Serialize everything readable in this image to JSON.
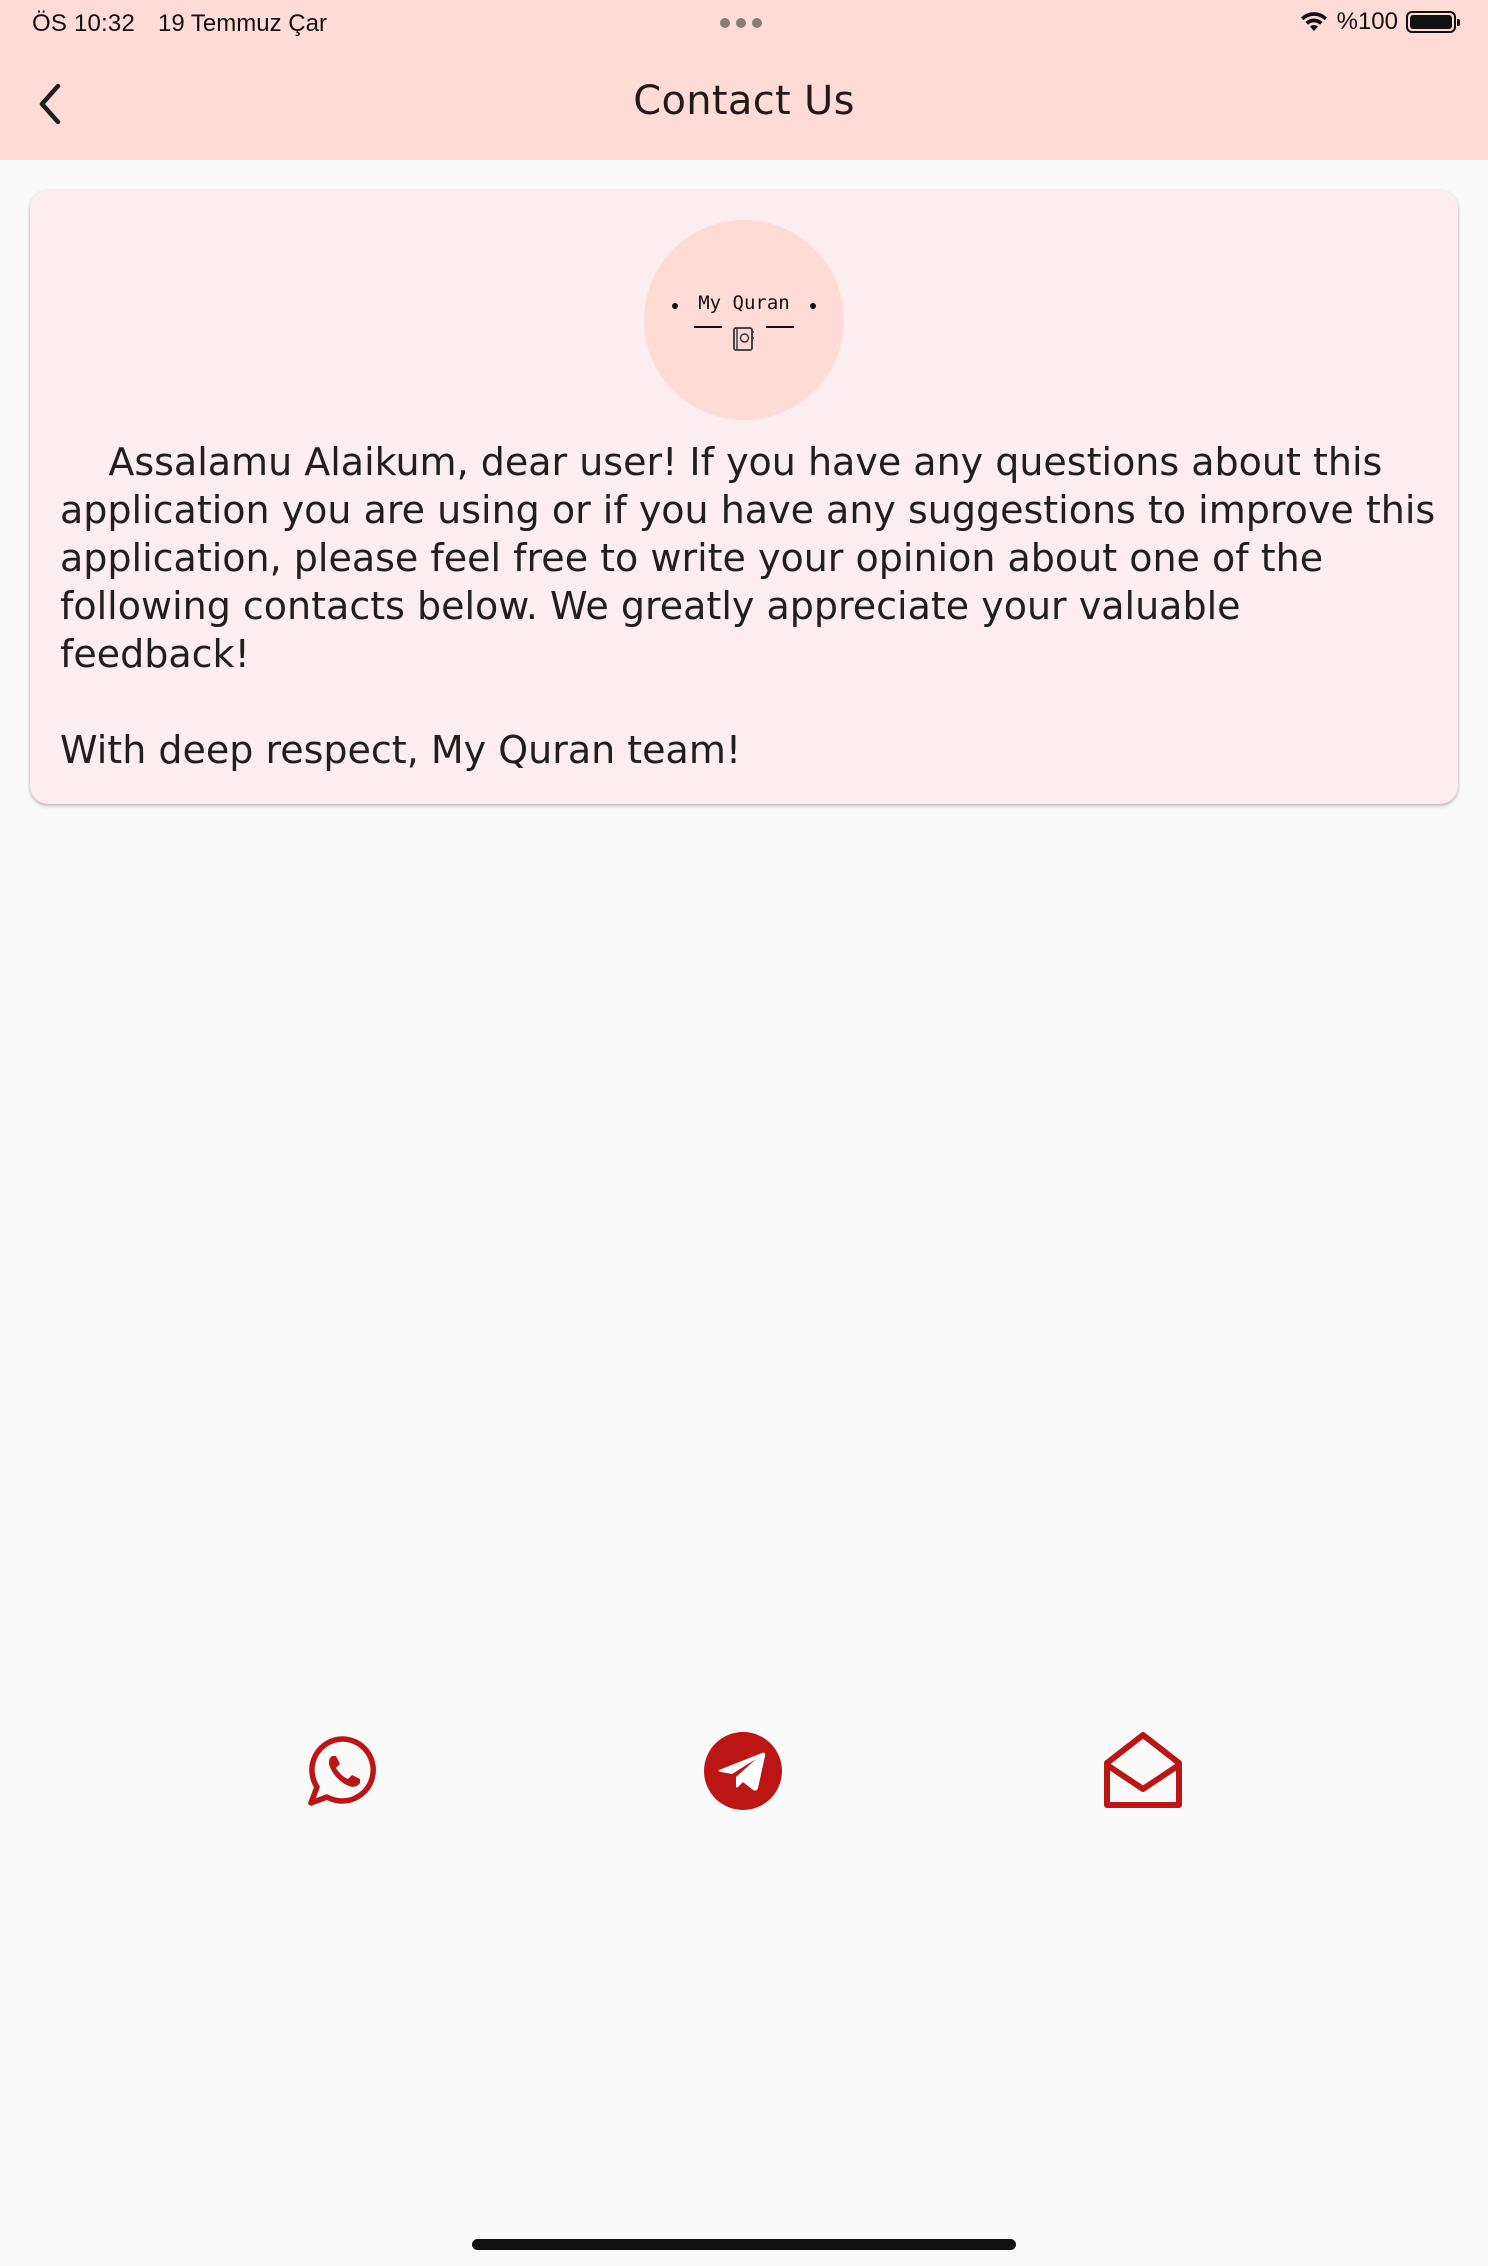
{
  "status_bar": {
    "time": "ÖS 10:32",
    "date": "19 Temmuz Çar",
    "battery": "%100"
  },
  "header": {
    "title": "Contact Us",
    "back_icon": "chevron-left-icon"
  },
  "card": {
    "logo_text": "My Quran",
    "logo_icon": "book-icon",
    "message": "    Assalamu Alaikum, dear user! If you have any questions about this application you are using or if you have any suggestions to improve this application, please feel free to write your opinion about one of the following contacts below. We greatly appreciate your valuable feedback!\n\nWith deep respect, My Quran team!"
  },
  "contacts": [
    {
      "name": "whatsapp",
      "icon": "whatsapp-icon"
    },
    {
      "name": "telegram",
      "icon": "telegram-icon"
    },
    {
      "name": "email",
      "icon": "envelope-open-icon"
    }
  ],
  "colors": {
    "app_bar": "#ffdbd6",
    "card": "#fcedf0",
    "accent": "#bb1614",
    "background": "#fafafa"
  }
}
